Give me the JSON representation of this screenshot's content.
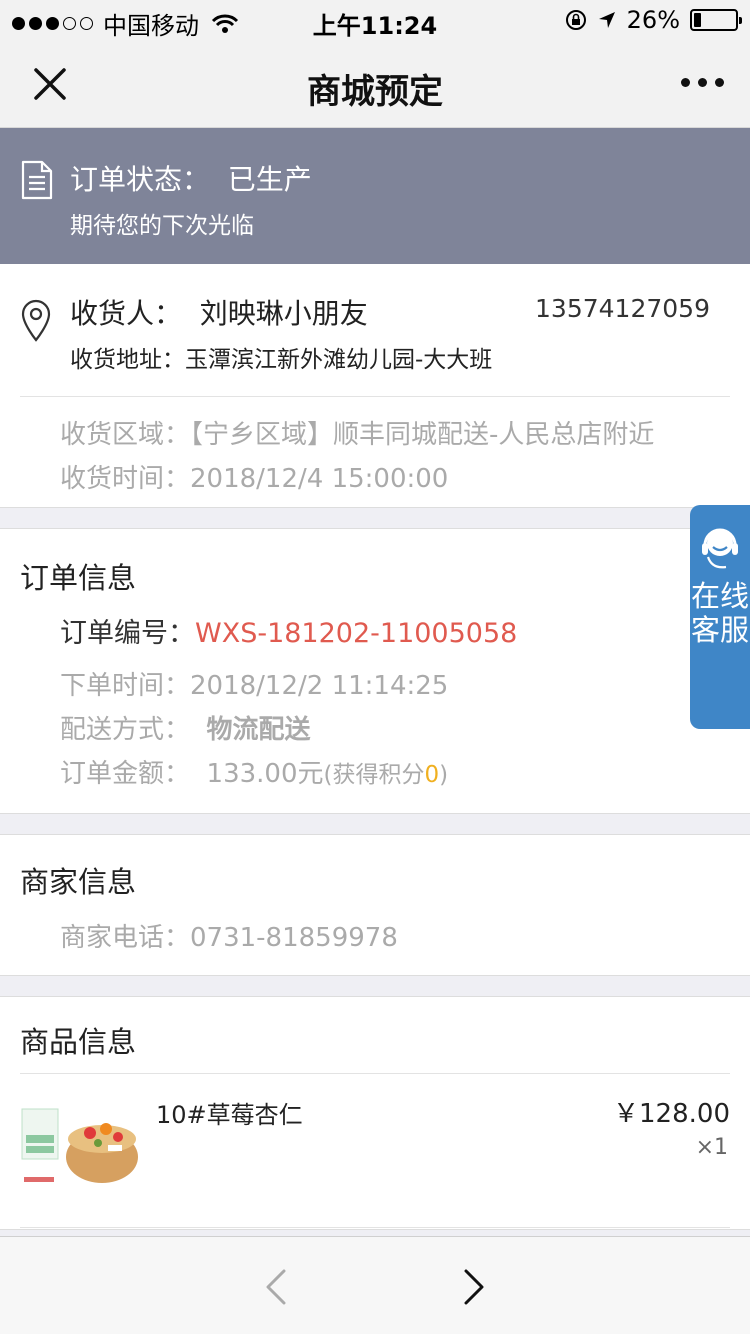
{
  "status_bar": {
    "carrier": "中国移动",
    "time": "上午11:24",
    "battery": "26%",
    "battery_level": 0.26
  },
  "nav": {
    "title": "商城预定"
  },
  "order_status": {
    "title": "订单状态：  已生产",
    "subtitle": "期待您的下次光临"
  },
  "address": {
    "recipient": "收货人：  刘映琳小朋友",
    "phone": "13574127059",
    "address": "收货地址：玉潭滨江新外滩幼儿园-大大班",
    "area": "收货区域：【宁乡区域】顺丰同城配送-人民总店附近",
    "time": "收货时间：2018/12/4 15:00:00"
  },
  "order_info": {
    "title": "订单信息",
    "number_label": "订单编号：",
    "number": "WXS-181202-11005058",
    "order_time": "下单时间：2018/12/2 11:14:25",
    "delivery_label": "配送方式：  ",
    "delivery": "物流配送",
    "amount_label": "订单金额：  ",
    "amount": "133.00元",
    "points_prefix": "(获得积分",
    "points": "0",
    "points_suffix": ")"
  },
  "merchant": {
    "title": "商家信息",
    "phone": "商家电话：0731-81859978"
  },
  "product": {
    "title": "商品信息",
    "name": "10#草莓杏仁",
    "price": "￥128.00",
    "qty": "×1"
  },
  "service": {
    "label": "在线客服"
  },
  "colors": {
    "banner": "#7f8499",
    "order_number": "#e05a4f",
    "points": "#f0b020",
    "service_tab": "#3f86c7"
  }
}
